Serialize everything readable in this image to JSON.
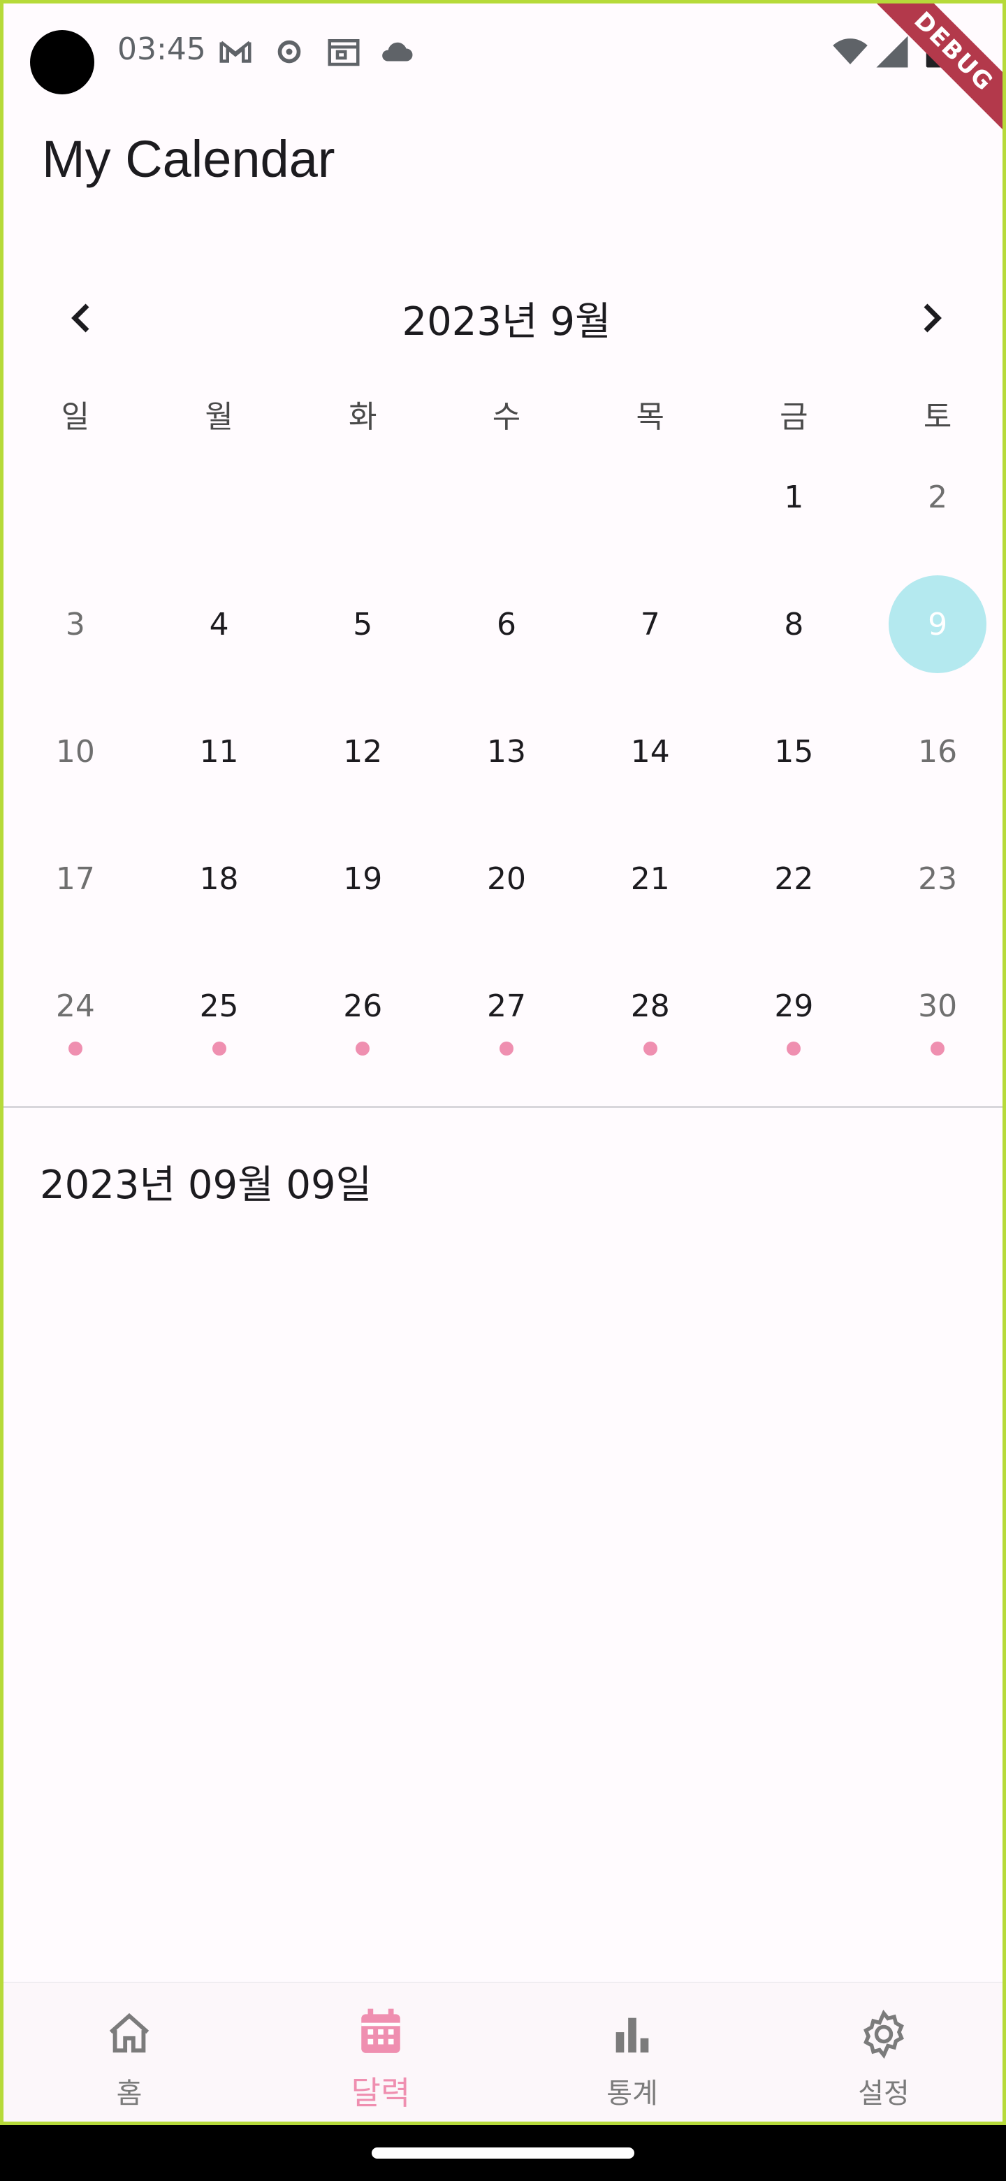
{
  "status_bar": {
    "time": "03:45",
    "icons": [
      "gmail-icon",
      "settings-icon",
      "calendar-widget-icon",
      "cloud-icon",
      "wifi-icon",
      "signal-icon",
      "battery-icon"
    ]
  },
  "debug_banner": "DEBUG",
  "app_bar": {
    "title": "My Calendar"
  },
  "calendar": {
    "month_title": "2023년 9월",
    "weekdays": [
      "일",
      "월",
      "화",
      "수",
      "목",
      "금",
      "토"
    ],
    "days": [
      "",
      "",
      "",
      "",
      "",
      "1",
      "2",
      "3",
      "4",
      "5",
      "6",
      "7",
      "8",
      "9",
      "10",
      "11",
      "12",
      "13",
      "14",
      "15",
      "16",
      "17",
      "18",
      "19",
      "20",
      "21",
      "22",
      "23",
      "24",
      "25",
      "26",
      "27",
      "28",
      "29",
      "30"
    ],
    "selected_day": "9",
    "days_with_events": [
      "24",
      "25",
      "26",
      "27",
      "28",
      "29",
      "30"
    ],
    "colors": {
      "selected": "#b4e9ef",
      "event_dot": "#ef8fb0"
    }
  },
  "selected_date_label": "2023년 09월 09일",
  "bottom_nav": {
    "items": [
      {
        "label": "홈",
        "icon": "home-icon",
        "active": false
      },
      {
        "label": "달력",
        "icon": "calendar-icon",
        "active": true
      },
      {
        "label": "통계",
        "icon": "bar-chart-icon",
        "active": false
      },
      {
        "label": "설정",
        "icon": "gear-icon",
        "active": false
      }
    ],
    "active_color": "#ef8fb0"
  }
}
